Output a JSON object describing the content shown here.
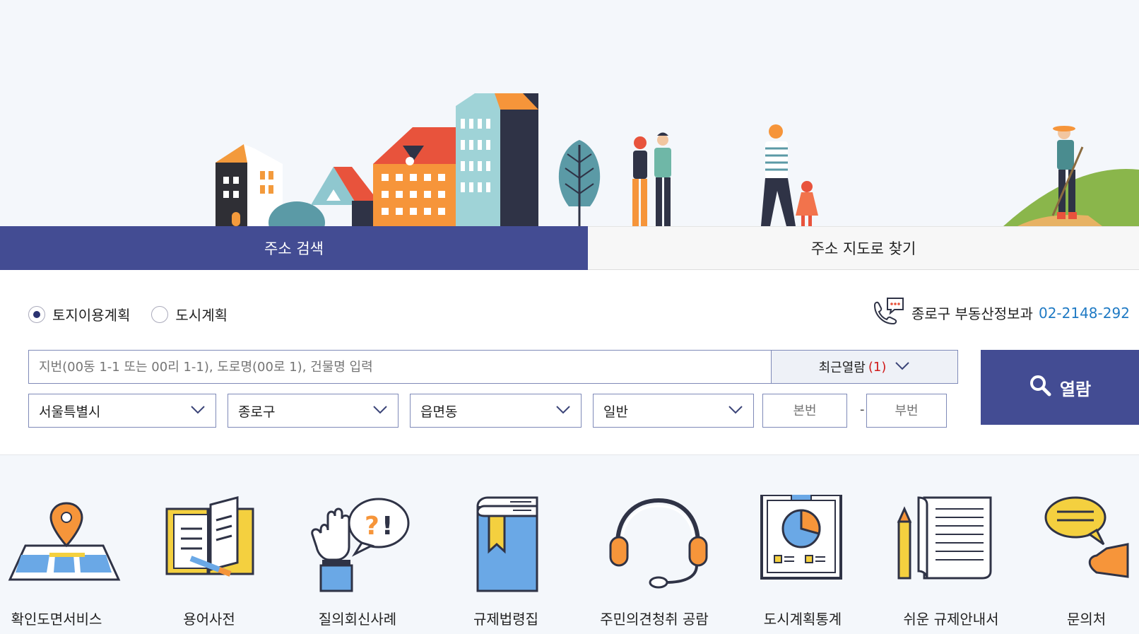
{
  "tabs": [
    {
      "label": "주소 검색",
      "active": true
    },
    {
      "label": "주소 지도로 찾기",
      "active": false
    }
  ],
  "plan_types": [
    {
      "label": "토지이용계획",
      "selected": true
    },
    {
      "label": "도시계획",
      "selected": false
    }
  ],
  "contact": {
    "office": "종로구 부동산정보과",
    "phone": "02-2148-292"
  },
  "search": {
    "placeholder": "지번(00동 1-1 또는 00리 1-1), 도로명(00로 1), 건물명 입력",
    "recent_label": "최근열람",
    "recent_count": "(1)",
    "button_label": "열람"
  },
  "filters": {
    "city": "서울특별시",
    "district": "종로구",
    "town": "읍면동",
    "type": "일반",
    "main_no_placeholder": "본번",
    "sub_no_placeholder": "부번",
    "separator": "-"
  },
  "services": [
    {
      "label": "확인도면서비스",
      "icon": "map-pin-icon"
    },
    {
      "label": "용어사전",
      "icon": "book-icon"
    },
    {
      "label": "질의회신사례",
      "icon": "question-hand-icon"
    },
    {
      "label": "규제법령집",
      "icon": "law-book-icon"
    },
    {
      "label": "주민의견청취 공람",
      "icon": "headset-icon"
    },
    {
      "label": "도시계획통계",
      "icon": "chart-board-icon"
    },
    {
      "label": "쉬운 규제안내서",
      "icon": "document-pencil-icon"
    },
    {
      "label": "문의처",
      "icon": "speech-bubble-icon"
    }
  ],
  "colors": {
    "primary": "#434c93",
    "accent_blue": "#1f7ac4",
    "count_red": "#d01a1a"
  }
}
